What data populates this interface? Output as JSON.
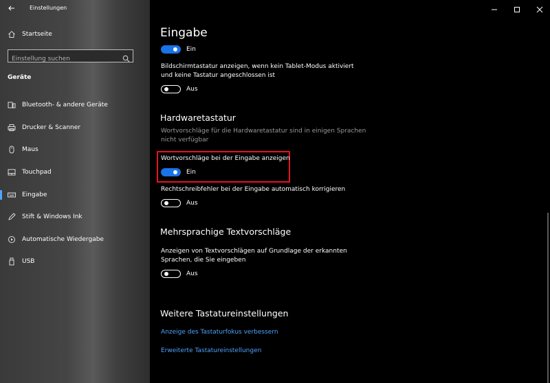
{
  "window": {
    "title": "Einstellungen"
  },
  "sidebar": {
    "home_label": "Startseite",
    "search_placeholder": "Einstellung suchen",
    "section_label": "Geräte",
    "items": [
      {
        "label": "Bluetooth- & andere Geräte",
        "icon": "bluetooth-device-icon"
      },
      {
        "label": "Drucker & Scanner",
        "icon": "printer-icon"
      },
      {
        "label": "Maus",
        "icon": "mouse-icon"
      },
      {
        "label": "Touchpad",
        "icon": "touchpad-icon"
      },
      {
        "label": "Eingabe",
        "icon": "keyboard-icon",
        "selected": true
      },
      {
        "label": "Stift & Windows Ink",
        "icon": "pen-icon"
      },
      {
        "label": "Automatische Wiedergabe",
        "icon": "autoplay-icon"
      },
      {
        "label": "USB",
        "icon": "usb-icon"
      }
    ]
  },
  "main": {
    "title": "Eingabe",
    "toggle_top": {
      "state": "Ein"
    },
    "touch_keyboard": {
      "text": "Bildschirmtastatur anzeigen, wenn kein Tablet-Modus aktiviert und keine Tastatur angeschlossen ist",
      "state": "Aus"
    },
    "hardware": {
      "heading": "Hardwaretastatur",
      "note": "Wortvorschläge für die Hardwaretastatur sind in einigen Sprachen nicht verfügbar",
      "suggestions": {
        "label": "Wortvorschläge bei der Eingabe anzeigen",
        "state": "Ein"
      },
      "autocorrect": {
        "label": "Rechtschreibfehler bei der Eingabe automatisch korrigieren",
        "state": "Aus"
      }
    },
    "multilingual": {
      "heading": "Mehrsprachige Textvorschläge",
      "text": "Anzeigen von Textvorschlägen auf Grundlage der erkannten Sprachen, die Sie eingeben",
      "state": "Aus"
    },
    "more": {
      "heading": "Weitere Tastatureinstellungen",
      "link1": "Anzeige des Tastaturfokus verbessern",
      "link2": "Erweiterte Tastatureinstellungen"
    }
  },
  "colors": {
    "accent": "#1a73e8",
    "link": "#4da3ff",
    "highlight": "#e81123"
  }
}
